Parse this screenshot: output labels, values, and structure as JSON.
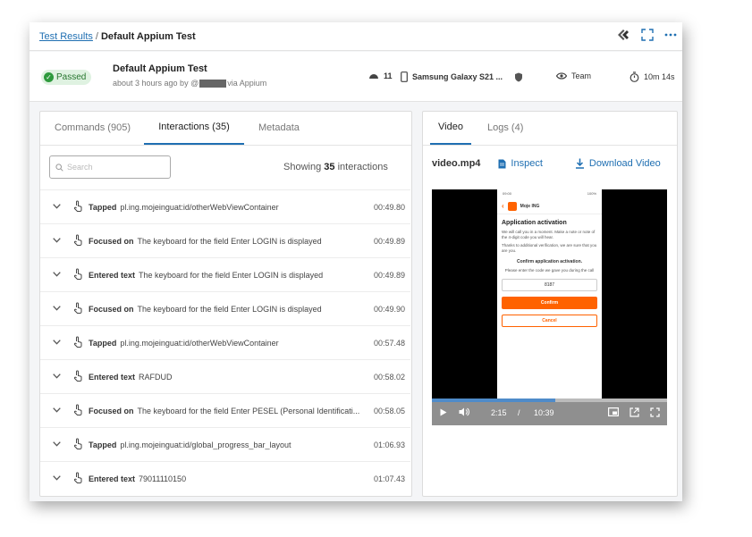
{
  "breadcrumb": {
    "link": "Test Results",
    "sep": "/",
    "current": "Default Appium Test"
  },
  "session": {
    "status": "Passed",
    "title": "Default Appium Test",
    "subtitle_prefix": "about 3 hours ago by @",
    "subtitle_suffix": "via Appium",
    "android_version": "11",
    "device": "Samsung Galaxy S21 ...",
    "visibility": "Team",
    "duration": "10m 14s"
  },
  "left_panel": {
    "tabs": [
      {
        "label": "Commands (905)"
      },
      {
        "label": "Interactions (35)"
      },
      {
        "label": "Metadata"
      }
    ],
    "search_placeholder": "Search",
    "showing_prefix": "Showing",
    "showing_count": "35",
    "showing_suffix": "interactions",
    "rows": [
      {
        "action": "Tapped",
        "detail": "pl.ing.mojeinguat:id/otherWebViewContainer",
        "time": "00:49.80"
      },
      {
        "action": "Focused on",
        "detail": "The keyboard for the field Enter LOGIN is displayed",
        "time": "00:49.89"
      },
      {
        "action": "Entered text",
        "detail": "The keyboard for the field Enter LOGIN is displayed",
        "time": "00:49.89"
      },
      {
        "action": "Focused on",
        "detail": "The keyboard for the field Enter LOGIN is displayed",
        "time": "00:49.90"
      },
      {
        "action": "Tapped",
        "detail": "pl.ing.mojeinguat:id/otherWebViewContainer",
        "time": "00:57.48"
      },
      {
        "action": "Entered text",
        "detail": "RAFDUD",
        "time": "00:58.02"
      },
      {
        "action": "Focused on",
        "detail": "The keyboard for the field Enter PESEL (Personal Identificati...",
        "time": "00:58.05"
      },
      {
        "action": "Tapped",
        "detail": "pl.ing.mojeinguat:id/global_progress_bar_layout",
        "time": "01:06.93"
      },
      {
        "action": "Entered text",
        "detail": "79011110150",
        "time": "01:07.43"
      }
    ]
  },
  "right_panel": {
    "tabs": [
      {
        "label": "Video"
      },
      {
        "label": "Logs (4)"
      }
    ],
    "filename": "video.mp4",
    "inspect": "Inspect",
    "download": "Download Video",
    "player": {
      "current": "2:15",
      "sep": "/",
      "total": "10:39",
      "progress": 0.525
    },
    "phone": {
      "status_left": "09:00",
      "status_right": "100%",
      "app_name": "Moje ING",
      "heading": "Application activation",
      "text1": "We will call you in a moment. Make a note or note of the 4-digit code you will hear.",
      "text2": "Thanks to additional verification, we are sure that you are you.",
      "confirm_heading": "Confirm application activation.",
      "prompt": "Please enter the code we gave you during the call",
      "code": "8187",
      "confirm": "Confirm",
      "cancel": "Cancel"
    }
  },
  "colors": {
    "accent": "#1f6fb2",
    "ing_orange": "#ff6200",
    "passed_green": "#2e9a3d"
  }
}
